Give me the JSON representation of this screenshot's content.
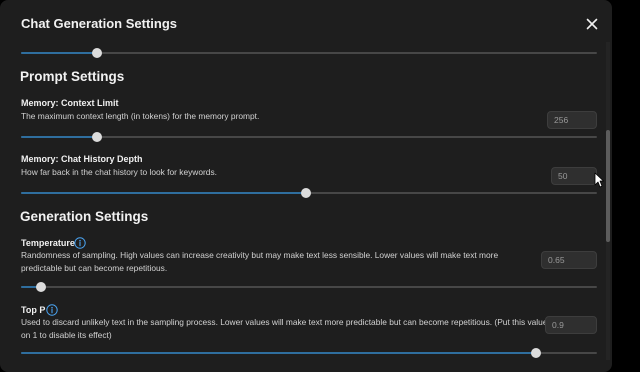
{
  "dialog": {
    "title": "Chat Generation Settings",
    "top_slider": {
      "fraction": 0.132
    }
  },
  "prompt_settings": {
    "title": "Prompt Settings",
    "context_limit": {
      "label": "Memory: Context Limit",
      "description": "The maximum context length (in tokens) for the memory prompt.",
      "value": "256",
      "fraction": 0.132
    },
    "history_depth": {
      "label": "Memory: Chat History Depth",
      "description": "How far back in the chat history to look for keywords.",
      "value": "50",
      "fraction": 0.495
    }
  },
  "generation_settings": {
    "title": "Generation Settings",
    "temperature": {
      "label": "Temperature",
      "description": "Randomness of sampling. High values can increase creativity but may make text less sensible. Lower values will make text more predictable but can become repetitious.",
      "value": "0.65",
      "fraction": 0.035
    },
    "top_p": {
      "label": "Top P",
      "description": "Used to discard unlikely text in the sampling process. Lower values will make text more predictable but can become repetitious. (Put this value on 1 to disable its effect)",
      "value": "0.9",
      "fraction": 0.894
    }
  },
  "icons": {
    "close": "close-icon",
    "info": "info-circle-icon",
    "cursor": "mouse-pointer-icon"
  },
  "colors": {
    "panel_bg": "#1e1e1e",
    "accent": "#2f6e9e",
    "info_icon": "#4aa3f0",
    "track": "#474747",
    "thumb": "#dcdcdc"
  }
}
